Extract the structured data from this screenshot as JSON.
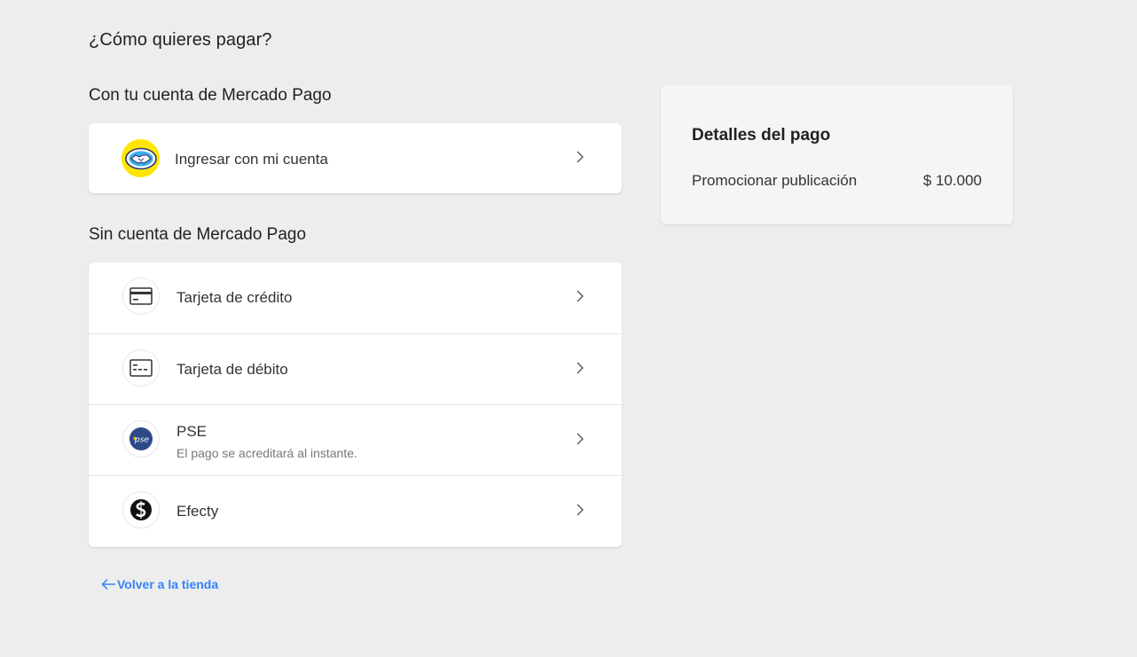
{
  "page": {
    "title": "¿Cómo quieres pagar?"
  },
  "with_account": {
    "title": "Con tu cuenta de Mercado Pago",
    "login_label": "Ingresar con mi cuenta"
  },
  "without_account": {
    "title": "Sin cuenta de Mercado Pago",
    "methods": [
      {
        "label": "Tarjeta de crédito",
        "icon": "credit-card-icon"
      },
      {
        "label": "Tarjeta de débito",
        "icon": "debit-card-icon"
      },
      {
        "label": "PSE",
        "sublabel": "El pago se acreditará al instante.",
        "icon": "pse-logo",
        "logo_text": "pse"
      },
      {
        "label": "Efecty",
        "icon": "efecty-logo"
      }
    ]
  },
  "back_link": {
    "label": "Volver a la tienda"
  },
  "summary": {
    "title": "Detalles del pago",
    "item_label": "Promocionar publicación",
    "item_amount": "$ 10.000"
  },
  "colors": {
    "background": "#ededed",
    "card": "#ffffff",
    "summary": "#f5f5f5",
    "link": "#3483fa",
    "mp_yellow": "#ffe600",
    "mp_blue": "#2d3277",
    "pse_blue": "#2c4a87"
  }
}
